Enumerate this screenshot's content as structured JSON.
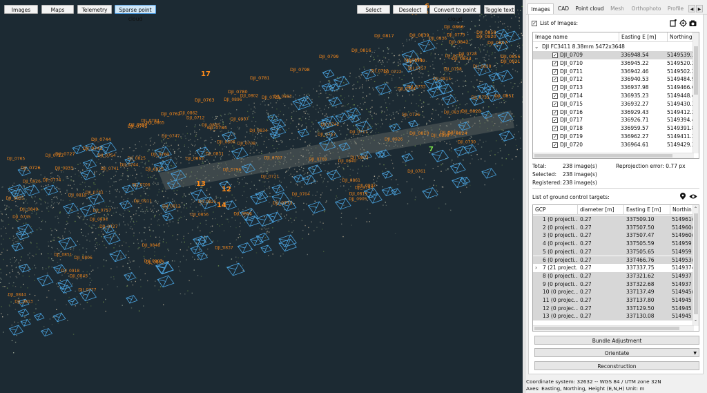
{
  "toolbar": {
    "images": "Images",
    "maps": "Maps",
    "telemetry": "Telemetry",
    "sparse": "Sparse point cloud",
    "select": "Select",
    "deselect": "Deselect",
    "convert": "Convert to point cloud",
    "toggle": "Toggle text"
  },
  "tabs": [
    "Images",
    "CAD",
    "Point cloud",
    "Mesh",
    "Orthophoto",
    "Profile"
  ],
  "images_panel": {
    "list_label": "List of Images:",
    "col_name": "Image name",
    "col_easting": "Easting E [m]",
    "col_northing": "Northing",
    "group": "DJI FC3411 8.38mm 5472x3648",
    "rows": [
      {
        "name": "DJI_0709",
        "e": "336948.54",
        "n": "5149539.3"
      },
      {
        "name": "DJI_0710",
        "e": "336945.22",
        "n": "5149520.2"
      },
      {
        "name": "DJI_0711",
        "e": "336942.46",
        "n": "5149502.2"
      },
      {
        "name": "DJI_0712",
        "e": "336940.53",
        "n": "5149484.9"
      },
      {
        "name": "DJI_0713",
        "e": "336937.98",
        "n": "5149466.6"
      },
      {
        "name": "DJI_0714",
        "e": "336935.23",
        "n": "5149448.4"
      },
      {
        "name": "DJI_0715",
        "e": "336932.27",
        "n": "5149430.3"
      },
      {
        "name": "DJI_0716",
        "e": "336929.43",
        "n": "5149412.2"
      },
      {
        "name": "DJI_0717",
        "e": "336926.71",
        "n": "5149394.4"
      },
      {
        "name": "DJI_0718",
        "e": "336959.57",
        "n": "5149391.8"
      },
      {
        "name": "DJI_0719",
        "e": "336962.27",
        "n": "5149411.3"
      },
      {
        "name": "DJI_0720",
        "e": "336964.61",
        "n": "5149429.3"
      }
    ],
    "total_label": "Total:",
    "total_value": "238 image(s)",
    "selected_label": "Selected:",
    "selected_value": "238 image(s)",
    "registered_label": "Registered:",
    "registered_value": "238 image(s)",
    "reproj": "Reprojection error:  0.77 px"
  },
  "gcp_panel": {
    "label": "List of ground control targets:",
    "col_gcp": "GCP",
    "col_diam": "diameter [m]",
    "col_east": "Easting E [m]",
    "col_north": "Northin",
    "rows": [
      {
        "id": "1 (0 projecti...",
        "d": "0.27",
        "e": "337509.10",
        "n": "514961("
      },
      {
        "id": "2 (0 projecti...",
        "d": "0.27",
        "e": "337507.50",
        "n": "514960("
      },
      {
        "id": "3 (0 projecti...",
        "d": "0.27",
        "e": "337507.47",
        "n": "514960("
      },
      {
        "id": "4 (0 projecti...",
        "d": "0.27",
        "e": "337505.59",
        "n": "514959"
      },
      {
        "id": "5 (0 projecti...",
        "d": "0.27",
        "e": "337505.65",
        "n": "514959"
      },
      {
        "id": "6 (0 projecti...",
        "d": "0.27",
        "e": "337466.76",
        "n": "514953("
      },
      {
        "id": "7 (21 project...",
        "d": "0.27",
        "e": "337337.75",
        "n": "5149374"
      },
      {
        "id": "8 (0 projecti...",
        "d": "0.27",
        "e": "337321.62",
        "n": "514937"
      },
      {
        "id": "9 (0 projecti...",
        "d": "0.27",
        "e": "337322.68",
        "n": "514937"
      },
      {
        "id": "10 (0 projec...",
        "d": "0.27",
        "e": "337137.49",
        "n": "514945("
      },
      {
        "id": "11 (0 projec...",
        "d": "0.27",
        "e": "337137.80",
        "n": "514945"
      },
      {
        "id": "12 (0 projec...",
        "d": "0.27",
        "e": "337129.50",
        "n": "514945"
      },
      {
        "id": "13 (0 projec...",
        "d": "0.27",
        "e": "337130.08",
        "n": "514945"
      }
    ]
  },
  "buttons": {
    "bundle": "Bundle Adjustment",
    "orientate": "Orientate",
    "reconstruction": "Reconstruction"
  },
  "footer": {
    "coord": "Coordinate system: 32632 -- WGS 84 / UTM zone 32N",
    "axes": "Axes: Easting, Northing, Height (E,N,H) Unit: m"
  },
  "viewport_labels": [
    "DJI_0861",
    "DJI_0840",
    "DJI_0866",
    "DJI_0858",
    "DJI_0817",
    "DJI_0839",
    "DJI_0842",
    "DJI_0857",
    "DJI_0816",
    "DJI_0799",
    "DJI_0843",
    "DJI_0920",
    "DJI_0798",
    "DJI_0856",
    "DJI_0921",
    "DJI_0781",
    "DJI_0780",
    "DJI_0851",
    "DJI_0763",
    "DJI_0828",
    "DJI_0762",
    "DJI_0744",
    "DJI_0745",
    "DJI_0727",
    "DJI_0726",
    "DJI_0810",
    "DJI_0824",
    "DJI_0743",
    "DJI_0784",
    "DJI_0773",
    "17",
    "13",
    "12",
    "14",
    "6",
    "7"
  ],
  "colors": {
    "viewport_bg": "#1c2a33",
    "camera": "#4aa3df",
    "label": "#ff8c1a",
    "gcp_green": "#7be34a"
  }
}
